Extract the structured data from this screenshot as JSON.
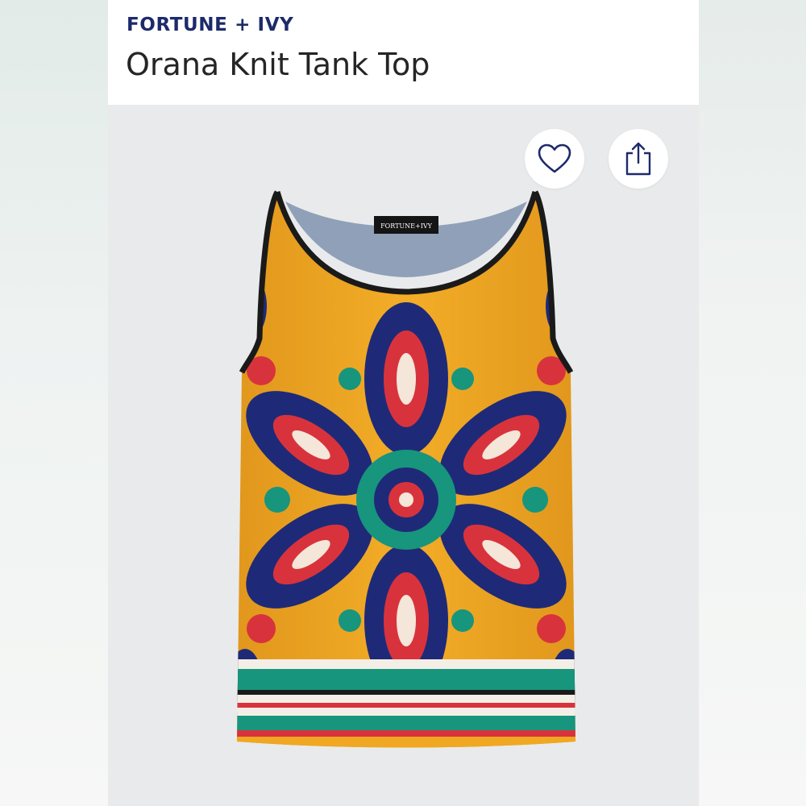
{
  "header": {
    "brand": "FORTUNE + IVY",
    "title": "Orana Knit Tank Top"
  },
  "product_image": {
    "tag_label": "FORTUNE+IVY",
    "colors": {
      "navy": "#1e2a78",
      "mustard": "#f0a722",
      "teal": "#17957d",
      "red": "#d8333c",
      "trim": "#1a1a1a"
    }
  },
  "actions": {
    "favorite_icon": "heart-outline-icon",
    "share_icon": "share-upload-icon"
  },
  "colors": {
    "brand_navy": "#1d2a6b",
    "title_text": "#252525",
    "photo_background": "#e9eaeb",
    "icon_color": "#1d2a6b"
  }
}
